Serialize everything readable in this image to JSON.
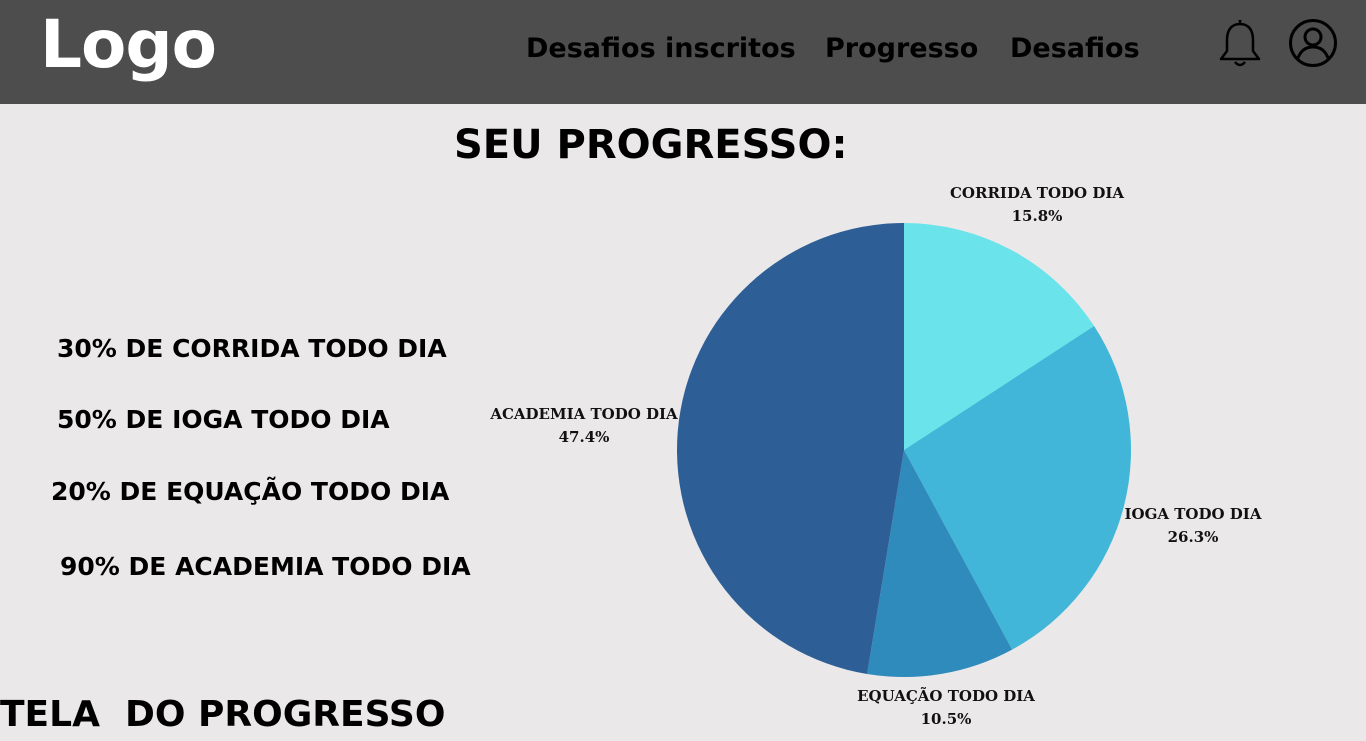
{
  "header": {
    "logo": "Logo",
    "nav": [
      "Desafios inscritos",
      "Progresso",
      "Desafios"
    ],
    "icons": [
      "bell-icon",
      "user-profile-icon"
    ]
  },
  "main": {
    "title": "SEU PROGRESSO:",
    "stats": [
      "30% DE CORRIDA TODO DIA",
      "50% DE IOGA TODO DIA",
      "20% DE EQUAÇÃO TODO DIA",
      "90% DE ACADEMIA TODO DIA"
    ]
  },
  "footer": {
    "title": "TELA  DO PROGRESSO"
  },
  "chart_data": {
    "type": "pie",
    "slices": [
      {
        "label": "CORRIDA TODO DIA",
        "value": 15.8,
        "display": "15.8%",
        "color": "#6ae4ea"
      },
      {
        "label": "IOGA TODO DIA",
        "value": 26.3,
        "display": "26.3%",
        "color": "#42b6d8"
      },
      {
        "label": "EQUAÇÃO TODO DIA",
        "value": 10.5,
        "display": "10.5%",
        "color": "#2e8bbc"
      },
      {
        "label": "ACADEMIA TODO DIA",
        "value": 47.4,
        "display": "47.4%",
        "color": "#2e5e96"
      }
    ]
  }
}
